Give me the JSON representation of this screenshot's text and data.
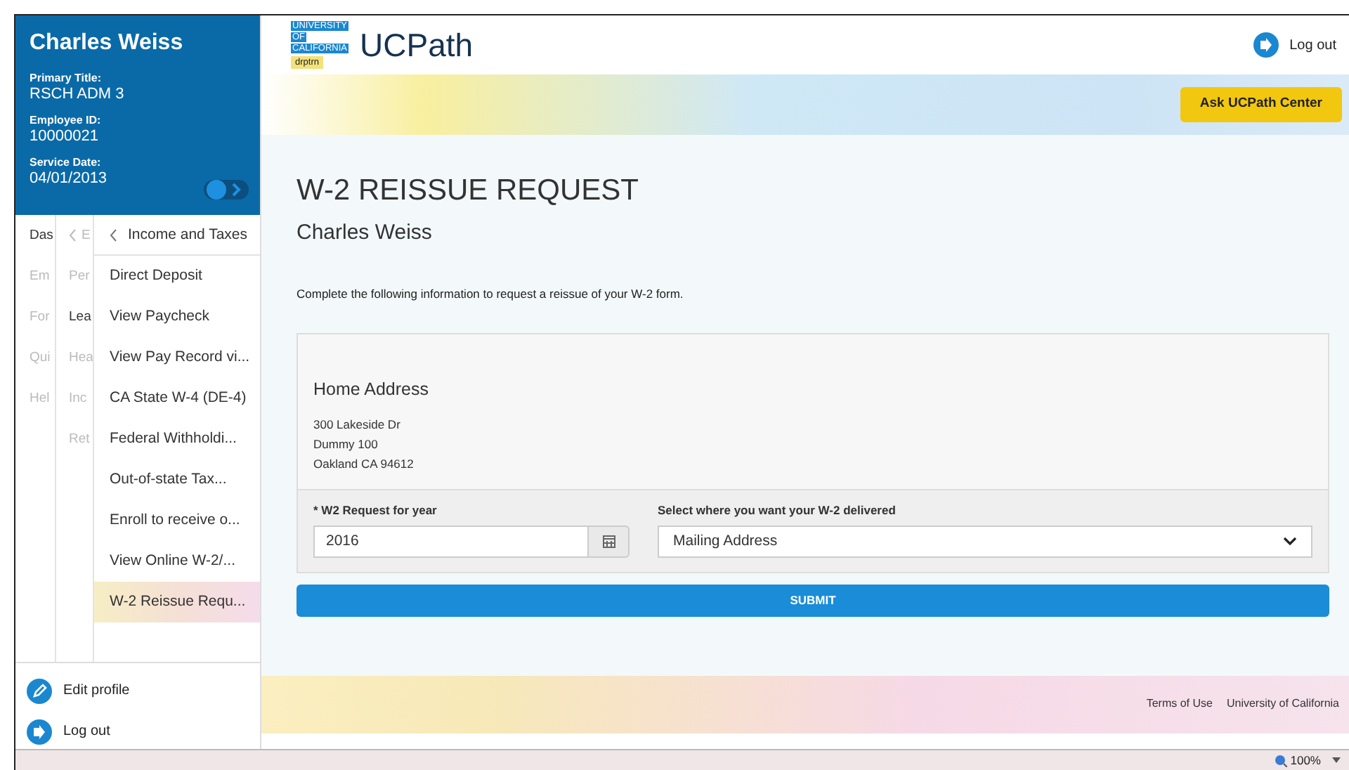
{
  "profile": {
    "name": "Charles Weiss",
    "fields": [
      {
        "label": "Primary Title:",
        "value": "RSCH ADM 3"
      },
      {
        "label": "Employee ID:",
        "value": "10000021"
      },
      {
        "label": "Service Date:",
        "value": "04/01/2013"
      }
    ]
  },
  "nav": {
    "column_1": [
      {
        "label": "Das",
        "muted": false
      },
      {
        "label": "Em",
        "muted": true
      },
      {
        "label": "For",
        "muted": true
      },
      {
        "label": "Qui",
        "muted": true
      },
      {
        "label": "Hel",
        "muted": true
      }
    ],
    "column_2": {
      "back": "E",
      "items": [
        {
          "label": "Per",
          "muted": true
        },
        {
          "label": "Lea",
          "muted": false
        },
        {
          "label": "Hea",
          "muted": true
        },
        {
          "label": "Inc",
          "muted": true
        },
        {
          "label": "Ret",
          "muted": true
        }
      ]
    },
    "column_3": {
      "back": "Income and Taxes",
      "items": [
        {
          "label": "Direct Deposit",
          "selected": false
        },
        {
          "label": "View Paycheck",
          "selected": false
        },
        {
          "label": "View Pay Record vi...",
          "selected": false
        },
        {
          "label": "CA State W-4 (DE-4)",
          "selected": false
        },
        {
          "label": "Federal Withholdi...",
          "selected": false
        },
        {
          "label": "Out-of-state Tax...",
          "selected": false
        },
        {
          "label": "Enroll to receive o...",
          "selected": false
        },
        {
          "label": "View Online W-2/...",
          "selected": false
        },
        {
          "label": "W-2 Reissue Requ...",
          "selected": true
        }
      ]
    }
  },
  "sidebar_footer": [
    {
      "label": "Edit profile",
      "kind": "edit"
    },
    {
      "label": "Log out",
      "kind": "logout"
    }
  ],
  "header": {
    "logo": [
      "UNIVERSITY",
      "OF",
      "CALIFORNIA"
    ],
    "env_tag": "drptrn",
    "app": "UCPath",
    "logout": "Log out"
  },
  "banner": {
    "button": "Ask UCPath Center"
  },
  "page": {
    "title": "W-2 REISSUE REQUEST",
    "subtitle": "Charles Weiss",
    "intro": "Complete the following information to request a reissue of your W-2 form."
  },
  "address": {
    "heading": "Home Address",
    "lines": [
      "300 Lakeside Dr",
      "Dummy 100",
      "Oakland CA 94612"
    ]
  },
  "form": {
    "year": {
      "label": "* W2 Request for year",
      "value": "2016"
    },
    "delivery": {
      "label": "Select where you want your W-2 delivered",
      "value": "Mailing Address"
    },
    "submit": "SUBMIT"
  },
  "footer": {
    "links": [
      "Terms of Use",
      "University of California"
    ]
  },
  "status_bar": {
    "zoom": "100%"
  }
}
